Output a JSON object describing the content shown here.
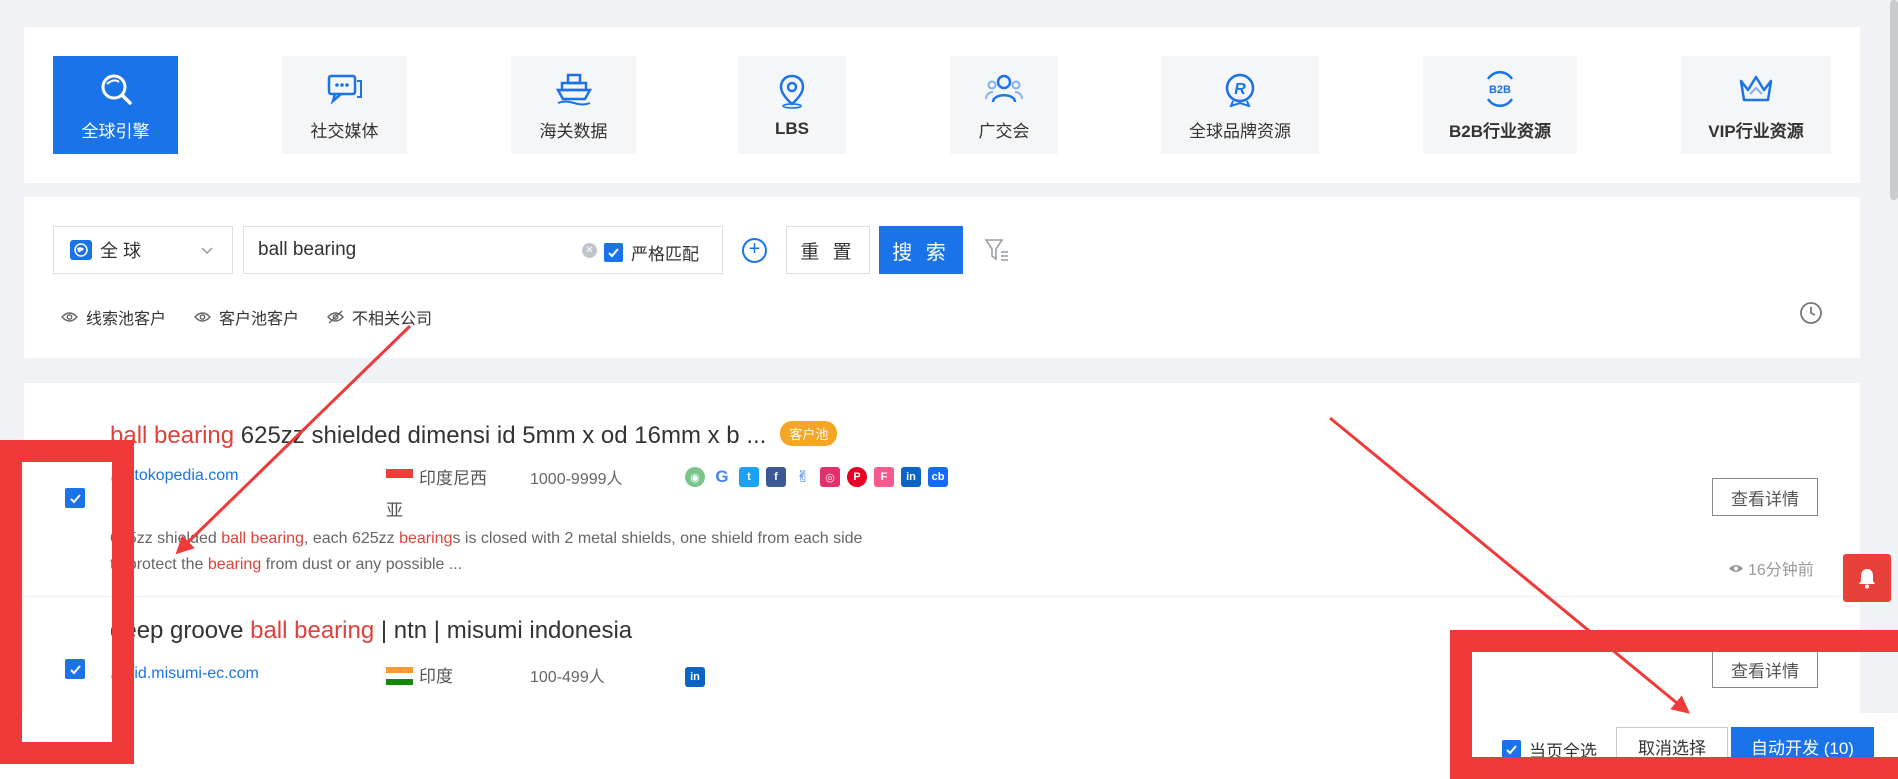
{
  "categories": [
    {
      "label": "全球引擎",
      "icon": "globe-search-icon",
      "active": true
    },
    {
      "label": "社交媒体",
      "icon": "chat-icon",
      "active": false
    },
    {
      "label": "海关数据",
      "icon": "ship-icon",
      "active": false
    },
    {
      "label": "LBS",
      "icon": "location-pin-icon",
      "active": false
    },
    {
      "label": "广交会",
      "icon": "people-icon",
      "active": false
    },
    {
      "label": "全球品牌资源",
      "icon": "registered-brand-icon",
      "active": false
    },
    {
      "label": "B2B行业资源",
      "icon": "b2b-icon",
      "active": false
    },
    {
      "label": "VIP行业资源",
      "icon": "crown-icon",
      "active": false
    }
  ],
  "search": {
    "region": "全 球",
    "keyword": "ball bearing",
    "strict_label": "严格匹配",
    "reset_label": "重 置",
    "search_label": "搜 索",
    "pools": [
      "线索池客户",
      "客户池客户",
      "不相关公司"
    ]
  },
  "results": [
    {
      "title_hl": "ball bearing",
      "title_rest": " 625zz shielded dimensi id 5mm x od 16mm x b ...",
      "tag": "客户池",
      "domain": "tokopedia.com",
      "country": "印度尼西亚",
      "employees": "1000-9999人",
      "desc_parts": [
        "625zz shielded ",
        "ball bearing",
        ", each 625zz ",
        "bearing",
        "s is closed with 2 metal shields, one shield from each side to protect the ",
        "bearing",
        " from dust or any possible ..."
      ],
      "detail_label": "查看详情",
      "time": "16分钟前"
    },
    {
      "title_pre": "deep groove ",
      "title_hl": "ball bearing",
      "title_rest": " | ntn | misumi indonesia",
      "domain": "id.misumi-ec.com",
      "country": "印度",
      "employees": "100-499人",
      "detail_label": "查看详情"
    }
  ],
  "actionbar": {
    "select_all": "当页全选",
    "cancel": "取消选择",
    "auto": "自动开发 (10)"
  },
  "colors": {
    "accent": "#1a73e8",
    "highlight": "#e0413a",
    "annotation": "#f03a3a"
  }
}
